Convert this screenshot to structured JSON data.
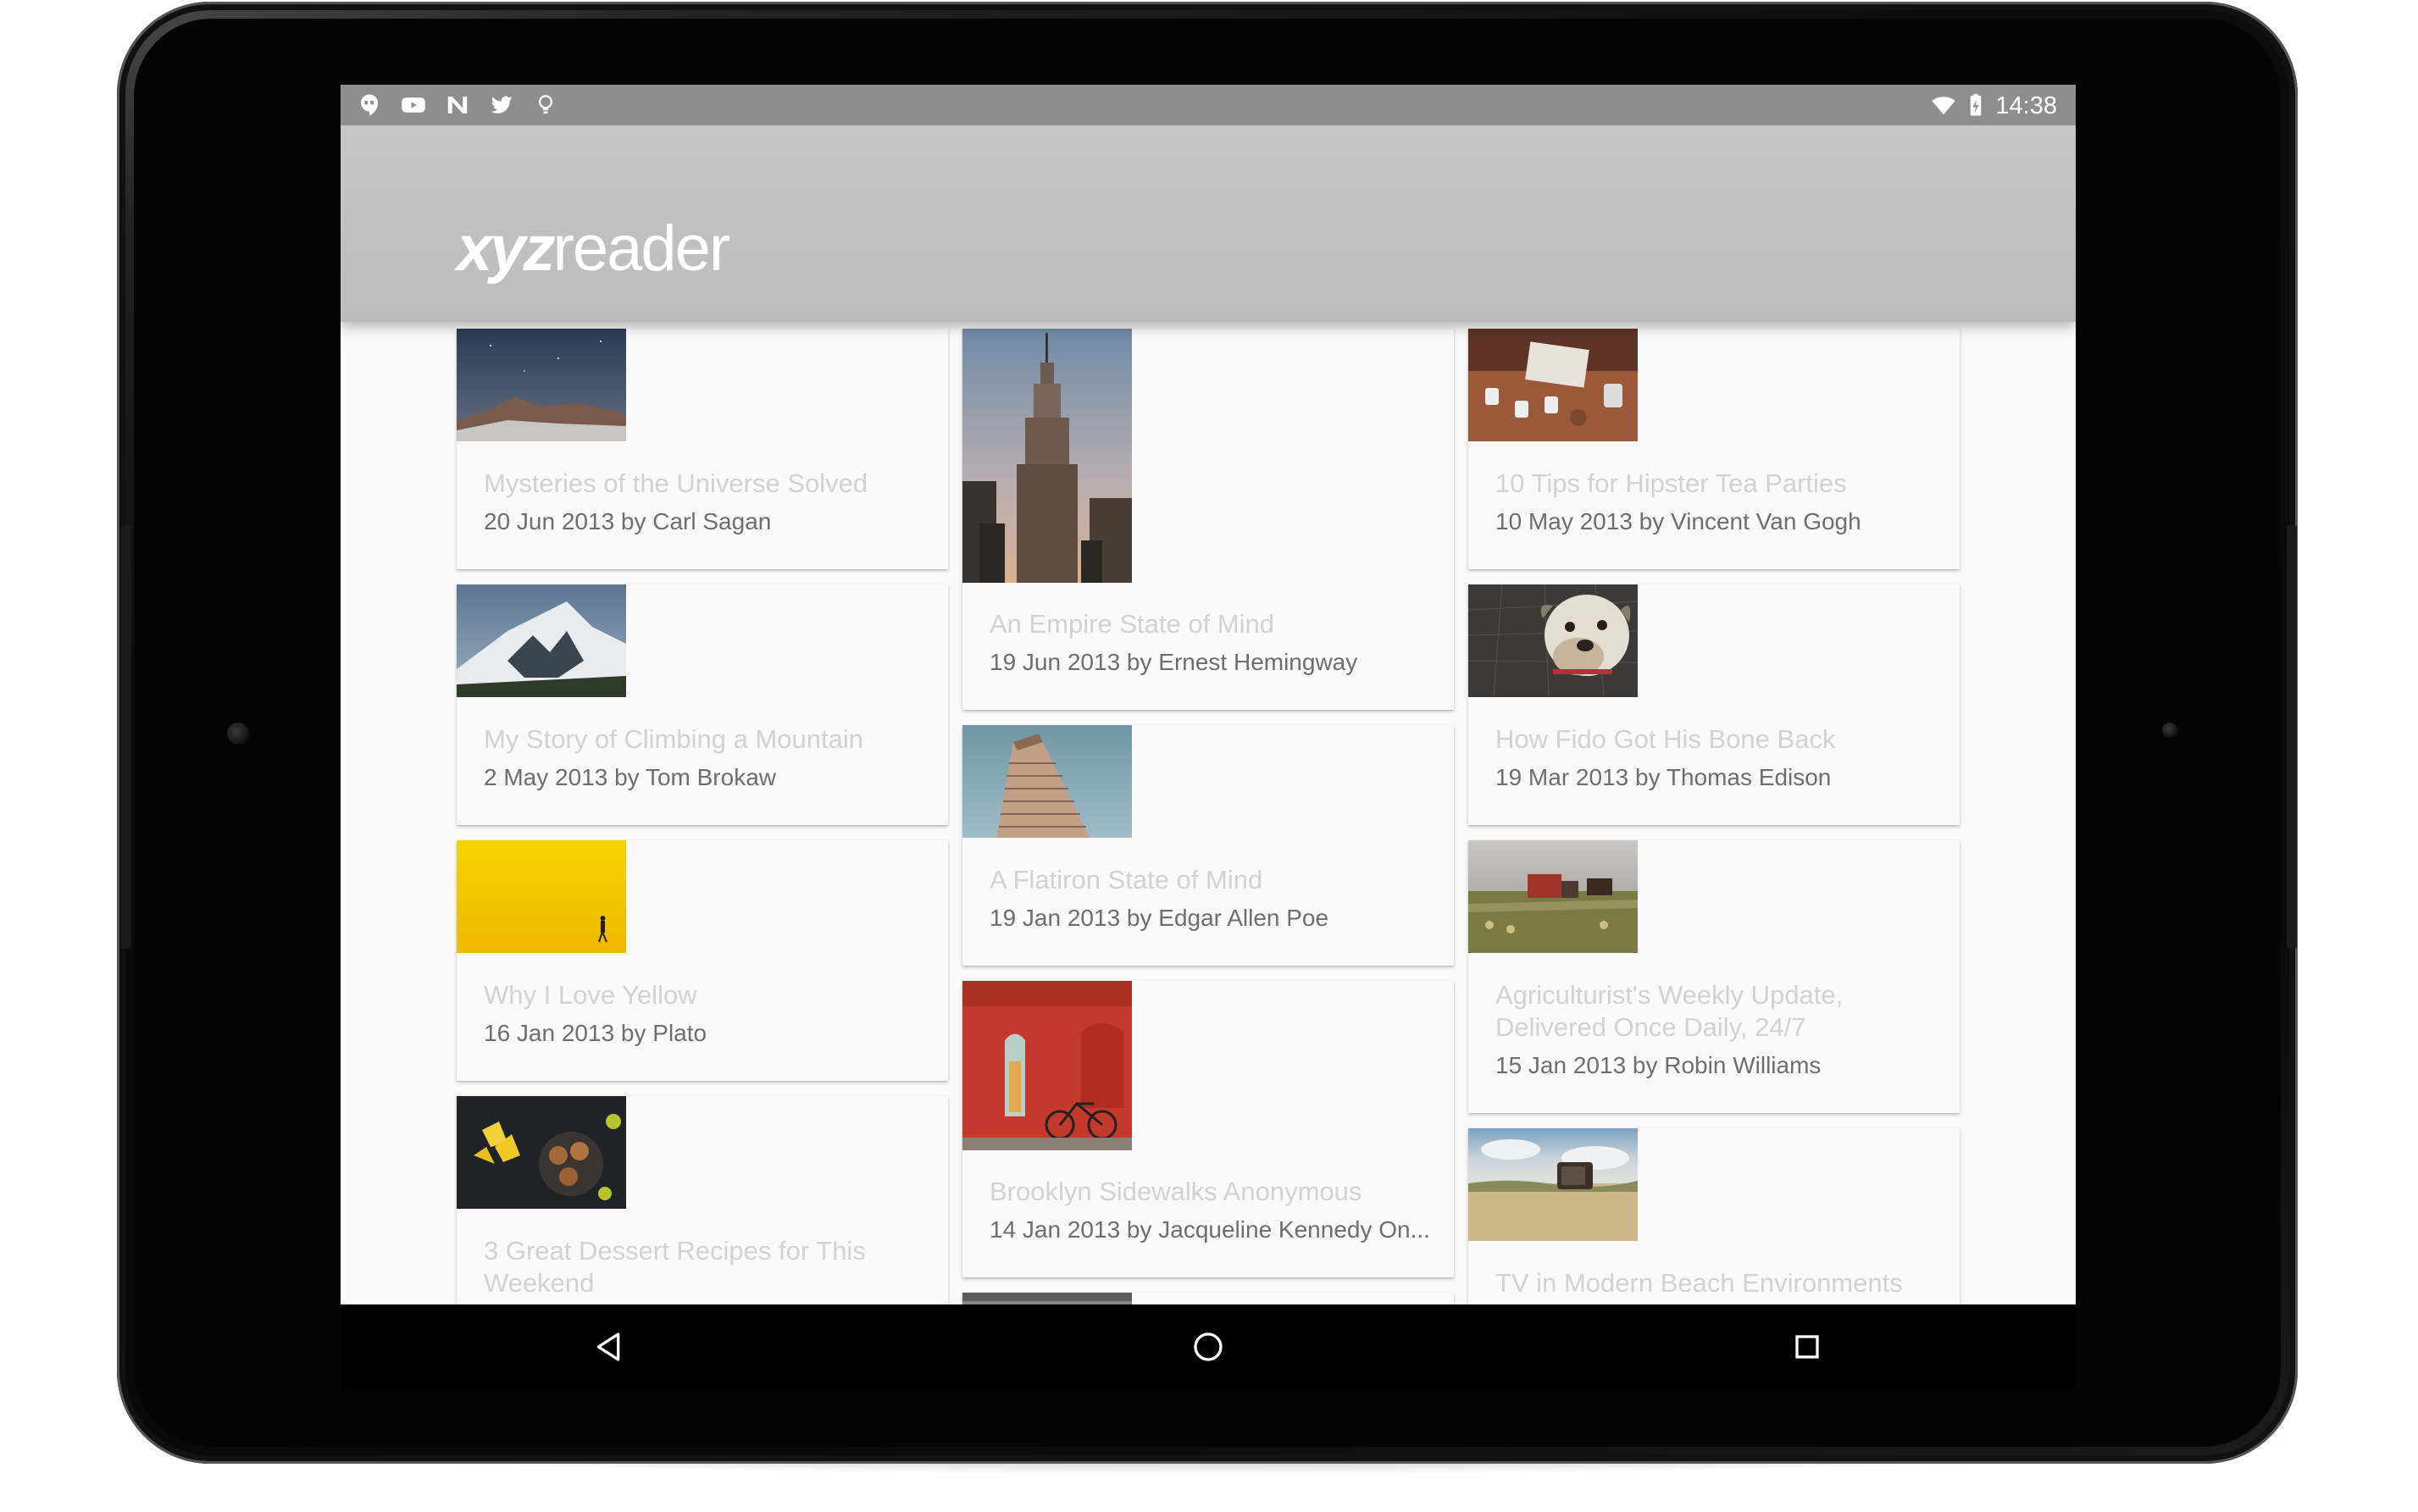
{
  "status_bar": {
    "left_icons": [
      "hangouts-icon",
      "youtube-icon",
      "newsstand-icon",
      "twitter-icon",
      "lightbulb-icon"
    ],
    "right_icons": [
      "wifi-icon",
      "battery-charging-icon"
    ],
    "time": "14:38"
  },
  "app": {
    "logo_bold": "xyz",
    "logo_light": "reader"
  },
  "articles": [
    {
      "title": "Mysteries of the Universe Solved",
      "meta": "20 Jun 2013 by Carl Sagan",
      "image": "night-sky-mountains"
    },
    {
      "title": "An Empire State of Mind",
      "meta": "19 Jun 2013 by Ernest Hemingway",
      "image": "empire-state-building"
    },
    {
      "title": "10 Tips for Hipster Tea Parties",
      "meta": "10 May 2013 by Vincent Van Gogh",
      "image": "tea-table"
    },
    {
      "title": "My Story of Climbing a Mountain",
      "meta": "2 May 2013 by Tom Brokaw",
      "image": "snowy-mountain"
    },
    {
      "title": "How Fido Got His Bone Back",
      "meta": "19 Mar 2013 by Thomas Edison",
      "image": "bulldog"
    },
    {
      "title": "A Flatiron State of Mind",
      "meta": "19 Jan 2013 by Edgar Allen Poe",
      "image": "flatiron-building"
    },
    {
      "title": "Why I Love Yellow",
      "meta": "16 Jan 2013 by Plato",
      "image": "yellow-wall"
    },
    {
      "title": "Agriculturist's Weekly Update, Delivered Once Daily, 24/7",
      "meta": "15 Jan 2013 by Robin Williams",
      "image": "farm-field"
    },
    {
      "title": "Brooklyn Sidewalks Anonymous",
      "meta": "14 Jan 2013 by Jacqueline Kennedy On...",
      "image": "red-wall-bicycle"
    },
    {
      "title": "3 Great Dessert Recipes for This Weekend",
      "meta": "",
      "image": "dessert-flowers"
    },
    {
      "title": "TV in Modern Beach Environments",
      "meta": "",
      "image": "beach-tv"
    }
  ],
  "nav_bar": {
    "back": "back-icon",
    "home": "home-icon",
    "recents": "recents-icon"
  }
}
